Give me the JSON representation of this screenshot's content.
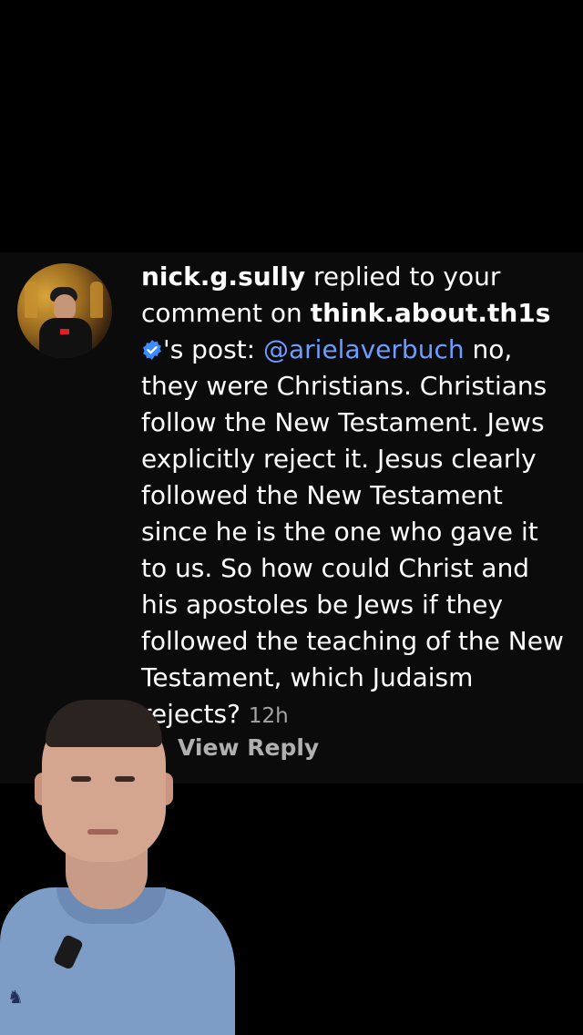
{
  "notification": {
    "username": "nick.g.sully",
    "action_text": " replied to your comment on ",
    "post_owner": "think.about.th1s",
    "post_suffix": "'s post: ",
    "mention": "@arielaverbuch",
    "body": " no, they were Christians. Christians follow the New Testament. Jews explicitly reject it. Jesus clearly followed the New Testament since he is the one who gave it to us. So how could Christ and his apostoles be Jews if they followed the teaching of the New Testament, which Judaism rejects?",
    "timestamp": "12h",
    "view_reply_label": "View Reply"
  },
  "colors": {
    "mention": "#6f9cff",
    "verified_badge": "#3d8bfd",
    "card_background": "#0b0b0c"
  },
  "icons": {
    "verified": "verified-badge-icon"
  }
}
